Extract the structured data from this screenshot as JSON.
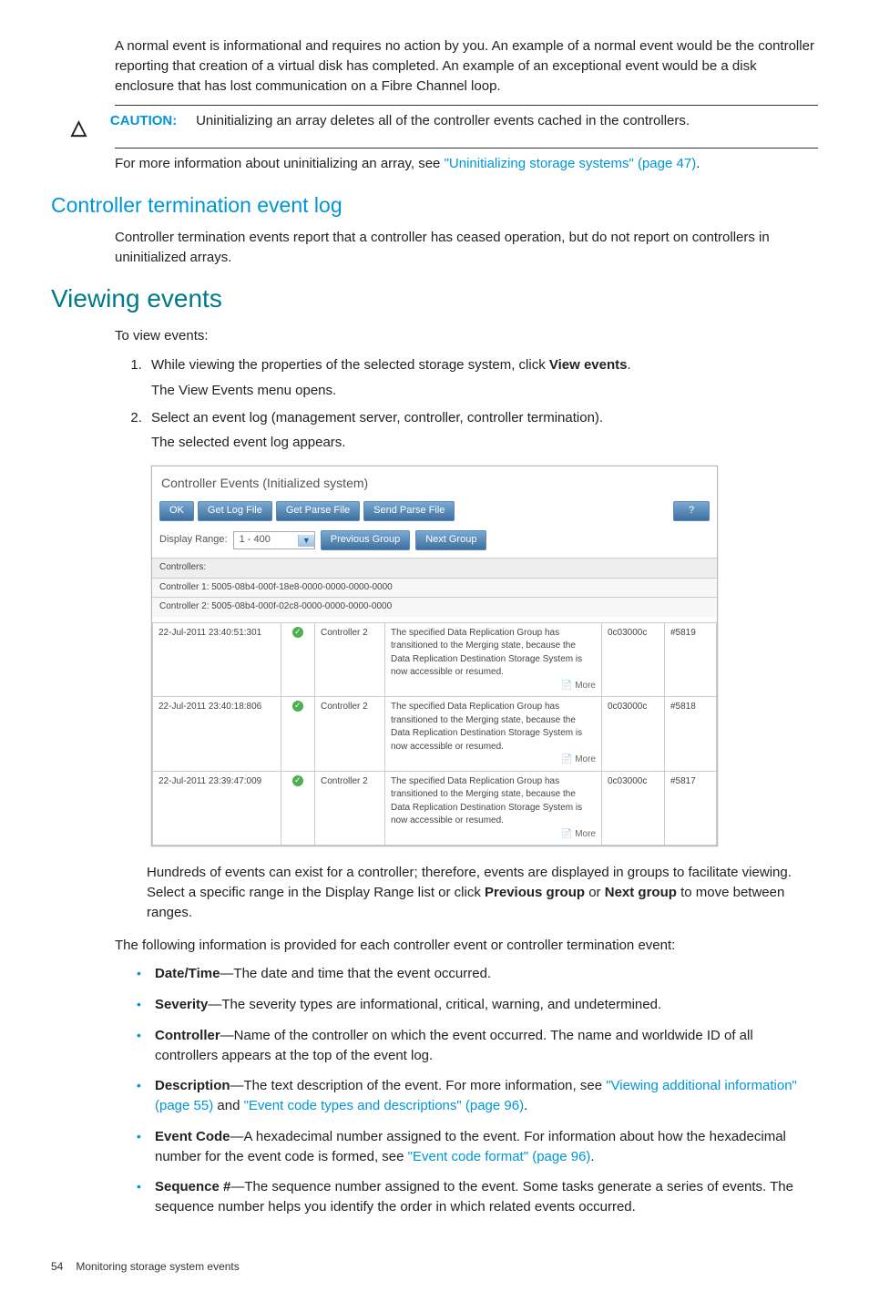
{
  "intro_para": "A normal event is informational and requires no action by you. An example of a normal event would be the controller reporting that creation of a virtual disk has completed. An example of an exceptional event would be a disk enclosure that has lost communication on a Fibre Channel loop.",
  "caution": {
    "label": "CAUTION:",
    "text": "Uninitializing an array deletes all of the controller events cached in the controllers."
  },
  "post_caution_prefix": "For more information about uninitializing an array, see ",
  "post_caution_link": "\"Uninitializing storage systems\" (page 47)",
  "post_caution_suffix": ".",
  "h_ctel": "Controller termination event log",
  "ctel_para": "Controller termination events report that a controller has ceased operation, but do not report on controllers in uninitialized arrays.",
  "h_viewing": "Viewing events",
  "viewing_lead": "To view events:",
  "steps": {
    "s1a": "While viewing the properties of the selected storage system, click ",
    "s1b_bold": "View events",
    "s1c": ".",
    "s1_sub": "The View Events menu opens.",
    "s2": "Select an event log (management server, controller, controller termination).",
    "s2_sub": "The selected event log appears."
  },
  "shot": {
    "title": "Controller Events  (Initialized system)",
    "btn_ok": "OK",
    "btn_getlog": "Get Log File",
    "btn_getparse": "Get Parse File",
    "btn_sendparse": "Send Parse File",
    "help": "?",
    "range_label": "Display Range:",
    "range_value": "1 - 400",
    "btn_prev": "Previous Group",
    "btn_next": "Next Group",
    "controllers_label": "Controllers:",
    "c1": "Controller 1: 5005-08b4-000f-18e8-0000-0000-0000-0000",
    "c2": "Controller 2: 5005-08b4-000f-02c8-0000-0000-0000-0000",
    "desc": "The specified Data Replication Group has transitioned to the Merging state, because the Data Replication Destination Storage System is now accessible or resumed.",
    "code": "0c03000c",
    "more": "More",
    "row1": {
      "ts": "22-Jul-2011 23:40:51:301",
      "ctrl": "Controller 2",
      "seq": "#5819"
    },
    "row2": {
      "ts": "22-Jul-2011 23:40:18:806",
      "ctrl": "Controller 2",
      "seq": "#5818"
    },
    "row3": {
      "ts": "22-Jul-2011 23:39:47:009",
      "ctrl": "Controller 2",
      "seq": "#5817"
    }
  },
  "after_shot": {
    "p1a": "Hundreds of events can exist for a controller; therefore, events are displayed in groups to facilitate viewing. Select a specific range in the Display Range list or click ",
    "p1b_bold": "Previous group",
    "p1c": " or ",
    "p1d_bold": "Next group",
    "p1e": " to move between ranges.",
    "p2": "The following information is provided for each controller event or controller termination event:"
  },
  "fields": {
    "f1_label": "Date/Time",
    "f1_text": "—The date and time that the event occurred.",
    "f2_label": "Severity",
    "f2_text": "—The severity types are informational, critical, warning, and undetermined.",
    "f3_label": "Controller",
    "f3_text": "—Name of the controller on which the event occurred. The name and worldwide ID of all controllers appears at the top of the event log.",
    "f4_label": "Description",
    "f4_text_a": "—The text description of the event. For more information, see ",
    "f4_link1": "\"Viewing additional information\" (page 55)",
    "f4_mid": " and ",
    "f4_link2": "\"Event code types and descriptions\" (page 96)",
    "f4_end": ".",
    "f5_label": "Event Code",
    "f5_text_a": "—A hexadecimal number assigned to the event. For information about how the hexadecimal number for the event code is formed, see ",
    "f5_link": "\"Event code format\" (page 96)",
    "f5_end": ".",
    "f6_label": "Sequence #",
    "f6_text": "—The sequence number assigned to the event. Some tasks generate a series of events. The sequence number helps you identify the order in which related events occurred."
  },
  "footer": {
    "page": "54",
    "title": "Monitoring storage system events"
  }
}
